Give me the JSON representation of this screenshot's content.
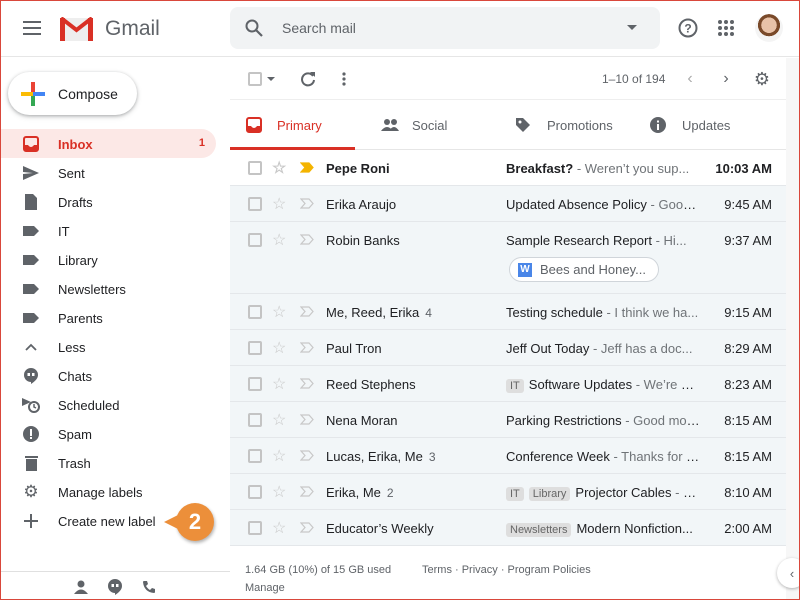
{
  "app": {
    "name": "Gmail"
  },
  "header": {
    "search_placeholder": "Search mail"
  },
  "compose_label": "Compose",
  "sidebar": {
    "items": [
      {
        "label": "Inbox",
        "count": "1",
        "icon": "inbox-icon",
        "active": true
      },
      {
        "label": "Sent",
        "icon": "send-icon"
      },
      {
        "label": "Drafts",
        "icon": "draft-icon"
      },
      {
        "label": "IT",
        "icon": "label-icon"
      },
      {
        "label": "Library",
        "icon": "label-icon"
      },
      {
        "label": "Newsletters",
        "icon": "label-icon"
      },
      {
        "label": "Parents",
        "icon": "label-icon"
      },
      {
        "label": "Less",
        "icon": "chevron-up-icon"
      },
      {
        "label": "Chats",
        "icon": "chat-icon"
      },
      {
        "label": "Scheduled",
        "icon": "scheduled-icon"
      },
      {
        "label": "Spam",
        "icon": "spam-icon"
      },
      {
        "label": "Trash",
        "icon": "trash-icon"
      },
      {
        "label": "Manage labels",
        "icon": "gear-icon"
      },
      {
        "label": "Create new label",
        "icon": "plus-icon"
      }
    ]
  },
  "toolbar": {
    "pager": "1–10 of 194"
  },
  "tabs": [
    {
      "label": "Primary"
    },
    {
      "label": "Social"
    },
    {
      "label": "Promotions"
    },
    {
      "label": "Updates"
    }
  ],
  "emails": [
    {
      "sender": "Pepe Roni",
      "count": "",
      "tags": [],
      "subject": "Breakfast?",
      "snippet": " - Weren’t you sup...",
      "time": "10:03 AM",
      "unread": true,
      "important": true
    },
    {
      "sender": "Erika Araujo",
      "count": "",
      "tags": [],
      "subject": "Updated Absence Policy",
      "snippet": " - Good...",
      "time": "9:45 AM"
    },
    {
      "sender": "Robin Banks",
      "count": "",
      "tags": [],
      "subject": "Sample Research Report",
      "snippet": " - Hi...",
      "time": "9:37 AM",
      "attachment": "Bees and Honey..."
    },
    {
      "sender": "Me, Reed, Erika",
      "count": "4",
      "tags": [],
      "subject": "Testing schedule",
      "snippet": " - I think we ha...",
      "time": "9:15 AM"
    },
    {
      "sender": "Paul Tron",
      "count": "",
      "tags": [],
      "subject": "Jeff Out Today ",
      "snippet": " - Jeff has a doc...",
      "time": "8:29 AM"
    },
    {
      "sender": "Reed Stephens",
      "count": "",
      "tags": [
        "IT"
      ],
      "subject": "Software Updates",
      "snippet": " - We’re go...",
      "time": "8:23 AM"
    },
    {
      "sender": "Nena Moran",
      "count": "",
      "tags": [],
      "subject": "Parking Restrictions",
      "snippet": " - Good mor...",
      "time": "8:15 AM"
    },
    {
      "sender": "Lucas, Erika, Me",
      "count": "3",
      "tags": [],
      "subject": "Conference Week",
      "snippet": " - Thanks for le...",
      "time": "8:15 AM"
    },
    {
      "sender": "Erika, Me",
      "count": "2",
      "tags": [
        "IT",
        "Library"
      ],
      "subject": "Projector Cables",
      "snippet": " - M...",
      "time": "8:10 AM"
    },
    {
      "sender": "Educator’s Weekly",
      "count": "",
      "tags": [
        "Newsletters"
      ],
      "subject": "Modern Nonfiction...",
      "snippet": "",
      "time": "2:00 AM"
    }
  ],
  "footer": {
    "storage": "1.64 GB (10%) of 15 GB used",
    "manage": "Manage",
    "links": "Terms · Privacy · Program Policies"
  },
  "callout": {
    "number": "2",
    "color": "#ec8f3a"
  },
  "colors": {
    "accent": "#d93025",
    "inbox_bg": "#fce8e6",
    "important": "#f4b400"
  }
}
